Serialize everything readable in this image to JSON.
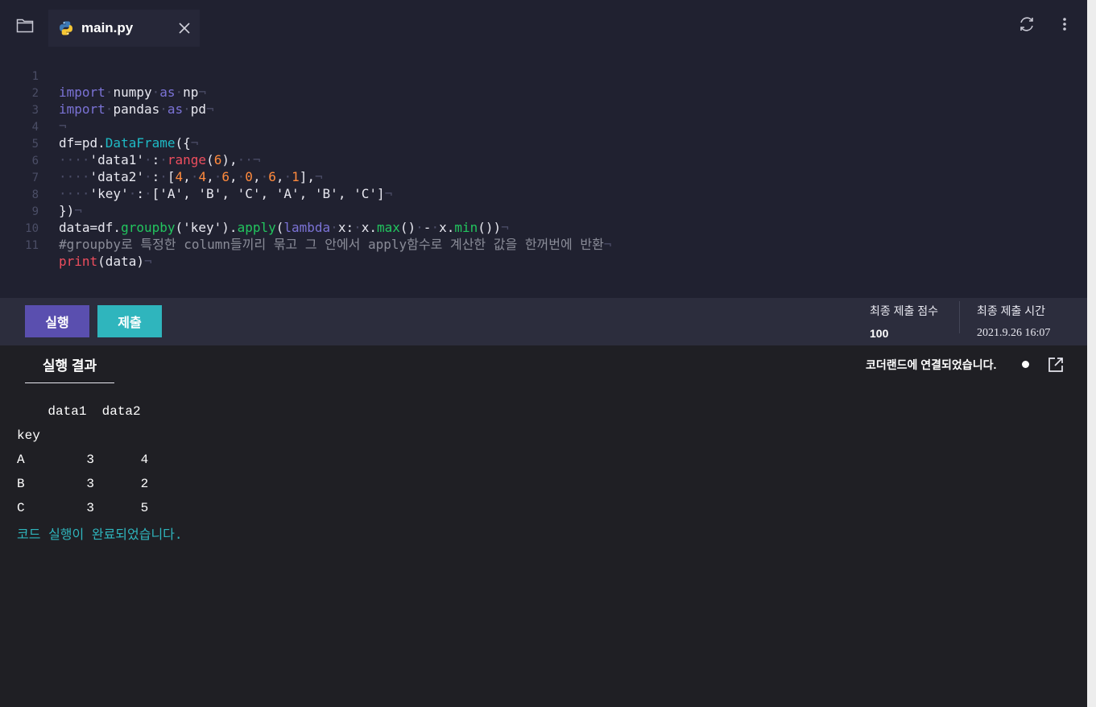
{
  "tab": {
    "filename": "main.py"
  },
  "editor": {
    "lines": [
      {
        "n": "1"
      },
      {
        "n": "2"
      },
      {
        "n": "3"
      },
      {
        "n": "4"
      },
      {
        "n": "5"
      },
      {
        "n": "6"
      },
      {
        "n": "7"
      },
      {
        "n": "8"
      },
      {
        "n": "9"
      },
      {
        "n": "10"
      },
      {
        "n": "11"
      }
    ],
    "tokens": {
      "l1_import": "import",
      "l1_mod": "numpy",
      "l1_as": "as",
      "l1_alias": "np",
      "l2_import": "import",
      "l2_mod": "pandas",
      "l2_as": "as",
      "l2_alias": "pd",
      "l4_a": "df=pd.",
      "l4_cls": "DataFrame",
      "l4_b": "({",
      "l5_key": "'data1'",
      "l5_colon": ":",
      "l5_fn": "range",
      "l5_p1": "(",
      "l5_n": "6",
      "l5_p2": "),",
      "l6_key": "'data2'",
      "l6_colon": ":",
      "l6_b1": "[",
      "l6_n1": "4",
      "l6_n2": "4",
      "l6_n3": "6",
      "l6_n4": "0",
      "l6_n5": "6",
      "l6_n6": "1",
      "l6_b2": "],",
      "l7_key": "'key'",
      "l7_colon": ":",
      "l7_list": "['A', 'B', 'C', 'A', 'B', 'C']",
      "l8": "})",
      "l9_a": "data=df.",
      "l9_gb": "groupby",
      "l9_b": "('key').",
      "l9_ap": "apply",
      "l9_c": "(",
      "l9_lam": "lambda",
      "l9_d": "x:",
      "l9_e": "x.",
      "l9_max": "max",
      "l9_f": "()",
      "l9_minus": "-",
      "l9_g": "x.",
      "l9_min": "min",
      "l9_h": "())",
      "l10": "#groupby로 특정한 column들끼리 묶고 그 안에서 apply함수로 계산한 값을 한꺼번에 반환",
      "l11_fn": "print",
      "l11_rest": "(data)",
      "pilcrow": "¬"
    }
  },
  "actions": {
    "run_label": "실행",
    "submit_label": "제출",
    "score_label": "최종 제출 점수",
    "score_value": "100",
    "time_label": "최종 제출 시간",
    "time_value": "2021.9.26 16:07"
  },
  "result": {
    "tab_label": "실행 결과",
    "connection_text": "코더랜드에 연결되었습니다.",
    "output_lines": [
      "    data1  data2",
      "key",
      "A        3      4",
      "B        3      2",
      "C        3      5"
    ],
    "done_text": "코드 실행이 완료되었습니다."
  }
}
